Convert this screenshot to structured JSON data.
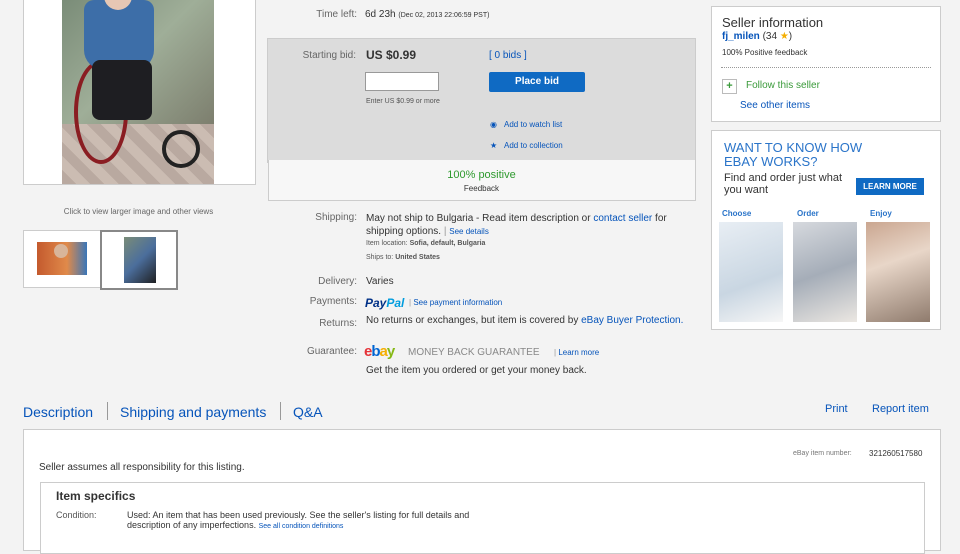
{
  "photo": {
    "caption": "Click to view larger image and other views"
  },
  "time_left": {
    "label": "Time left:",
    "value": "6d 23h",
    "detail": "(Dec 02, 2013   22:06:59 PST)"
  },
  "bid": {
    "starting_label": "Starting bid:",
    "starting_value": "US $0.99",
    "bids_link": "[ 0 bids ]",
    "input_value": "",
    "button": "Place bid",
    "hint": "Enter US $0.99 or more",
    "watch": "Add to watch list",
    "collection": "Add to collection",
    "feedback_percent": "100% positive",
    "feedback_label": "Feedback"
  },
  "details": {
    "shipping_label": "Shipping:",
    "shipping_text": "May not ship to Bulgaria - Read item description or",
    "contact_seller": "contact seller",
    "shipping_options": "for shipping options.",
    "see_details": "See details",
    "item_location_label": "Item location:",
    "item_location": "Sofia, default, Bulgaria",
    "ships_to_label": "Ships to:",
    "ships_to": "United States",
    "delivery_label": "Delivery:",
    "delivery_value": "Varies",
    "payments_label": "Payments:",
    "paypal_pay": "Pay",
    "paypal_pal": "Pal",
    "payment_info": "See payment information",
    "returns_label": "Returns:",
    "returns_text": "No returns or exchanges, but item is covered by",
    "returns_link": "eBay Buyer Protection.",
    "guarantee_label": "Guarantee:",
    "ebay_e": "e",
    "ebay_b": "b",
    "ebay_a": "a",
    "ebay_y": "y",
    "mbg": "MONEY BACK GUARANTEE",
    "learn_more": "Learn more",
    "guarantee_sub": "Get the item you ordered or get your money back."
  },
  "seller": {
    "title": "Seller information",
    "name": "fj_milen",
    "score": "(34",
    "score_close": ")",
    "feedback": "100% Positive feedback",
    "follow": "Follow this seller",
    "other_items": "See other items"
  },
  "ad": {
    "title": "WANT TO KNOW HOW EBAY WORKS?",
    "sub": "Find and order just what you want",
    "learn_more": "LEARN MORE",
    "step_choose": "Choose",
    "step_order": "Order",
    "step_enjoy": "Enjoy"
  },
  "tabs": {
    "description": "Description",
    "shipping": "Shipping and payments",
    "qa": "Q&A",
    "print": "Print",
    "report": "Report item"
  },
  "description": {
    "item_number_label": "eBay item number:",
    "item_number": "321260517580",
    "seller_note": "Seller assumes all responsibility for this listing.",
    "specifics_title": "Item specifics",
    "condition_label": "Condition:",
    "condition_text": "Used: An item that has been used previously. See the seller's listing for full details and description of any imperfections.",
    "condition_link": "See all condition definitions"
  }
}
